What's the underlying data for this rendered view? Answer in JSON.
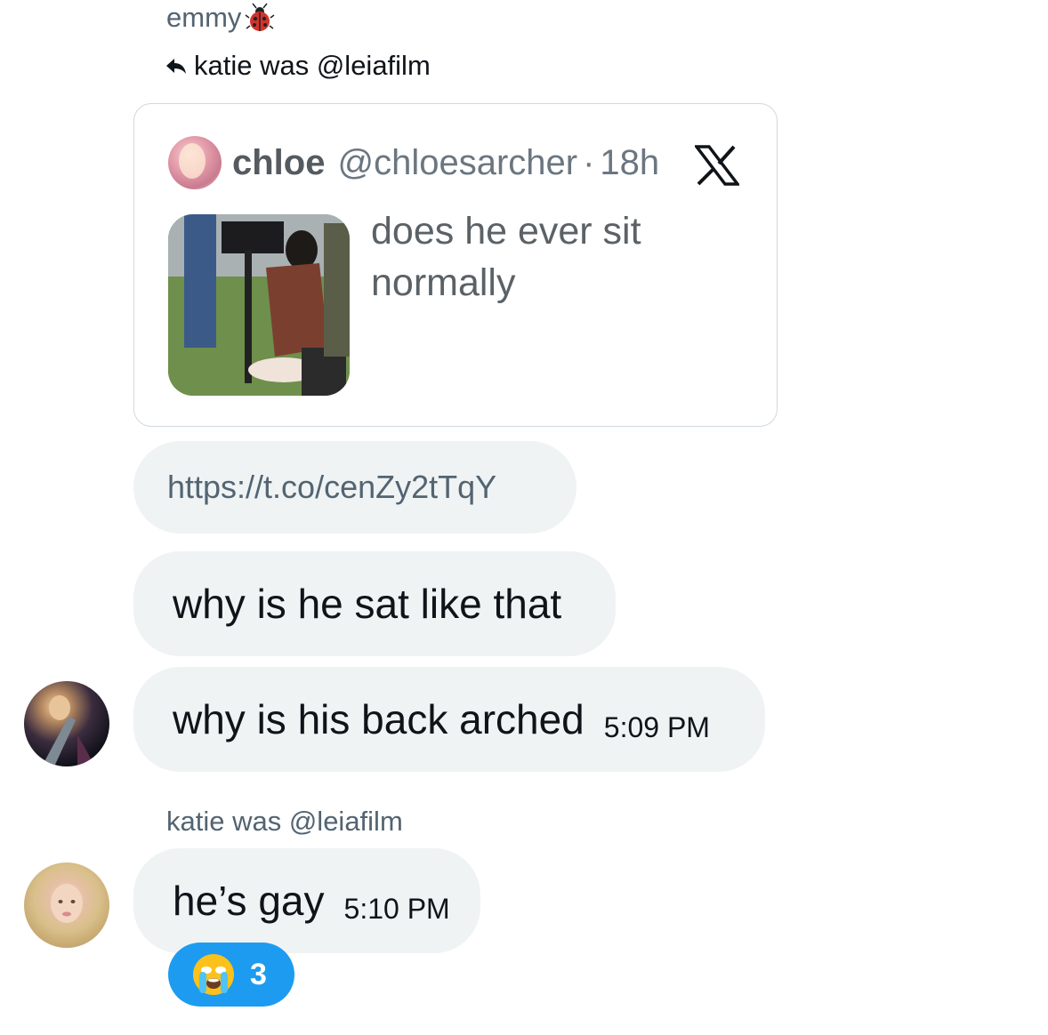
{
  "thread": {
    "sender_name": "emmy",
    "sender_emoji_icon": "ladybug-icon",
    "reply_to_label": "katie was @leiafilm"
  },
  "quote": {
    "display_name": "chloe",
    "handle": "@chloesarcher",
    "separator": "·",
    "time": "18h",
    "text": "does he ever sit normally"
  },
  "messages": [
    {
      "text": "https://t.co/cenZy2tTqY"
    },
    {
      "text": "why is he sat like that"
    },
    {
      "text": "why is his back arched",
      "time": "5:09 PM"
    }
  ],
  "reply": {
    "sender_name": "katie was @leiafilm",
    "text": "he’s gay",
    "time": "5:10 PM"
  },
  "reaction": {
    "emoji_icon": "crying-face-icon",
    "count": "3"
  },
  "colors": {
    "bubble": "#eff3f4",
    "secondary_text": "#536471",
    "reaction": "#1d9bf0"
  }
}
